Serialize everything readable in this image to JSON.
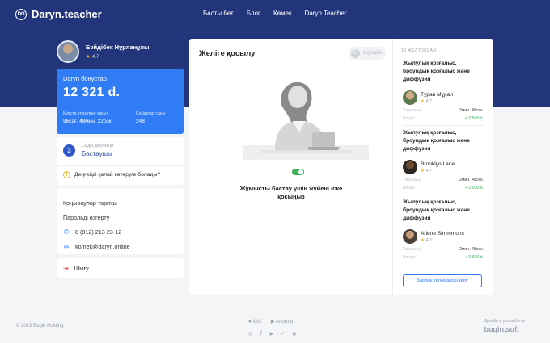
{
  "header": {
    "logo_mark": "DO",
    "brand": "Daryn.teacher",
    "nav": [
      "Басты бет",
      "Блог",
      "Көмек",
      "Daryn Teacher"
    ]
  },
  "profile": {
    "name": "Бәйдібек Нұрланұлы",
    "rating": "4.7"
  },
  "bonus": {
    "title": "Daryn бонустар",
    "amount": "12 321 d.",
    "time_label": "Курста өткізілген уақыт",
    "time_value": "96сағ. 48мин. 22сек.",
    "lessons_label": "Сабақтар саны",
    "lessons_value": "248"
  },
  "level": {
    "number": "3",
    "caption": "Сіздің деңгейіңіз",
    "name": "Бастаушы",
    "question": "Деңгейді қалай көтеруге болады?"
  },
  "menu": {
    "history": "Қоңыраулар тарихы",
    "password": "Парольді өзгерту",
    "phone": "8 (812) 213 23-12",
    "email": "komek@daryn.online",
    "logout": "Шығу"
  },
  "main": {
    "title": "Желіге қосылу",
    "status": "Офлайн",
    "caption": "Жұмысты бастау үшін жүйені іске қосыңыз"
  },
  "sidebar": {
    "date": "12 ЖЕЛТОҚСАН",
    "lessons": [
      {
        "title": "Жылулық қозғалыс, броундық қозғалыс және диффузия",
        "tutor": "Тұран Мұрал",
        "rating": "4.7",
        "time_label": "Уақытың:",
        "time": "2мин. 48сек.",
        "bonus_label": "Бонус:",
        "bonus": "+ 2 500 d."
      },
      {
        "title": "Жылулық қозғалыс, броундық қозғалыс және диффузия",
        "tutor": "Brooklyn Lane",
        "rating": "4.7",
        "time_label": "Уақытың:",
        "time": "2мин. 48сек.",
        "bonus_label": "Бонус:",
        "bonus": "+ 2 500 d."
      },
      {
        "title": "Жылулық қозғалыс, броундық қозғалыс және диффузия",
        "tutor": "Arlene Simmmons",
        "rating": "4.7",
        "time_label": "Уақытың:",
        "time": "2мин. 48сек.",
        "bonus_label": "Бонус:",
        "bonus": "+ 2 500 d."
      }
    ],
    "all_button": "Барлық төлемдерді көру"
  },
  "footer": {
    "copyright": "© 2019 Bugin Holding",
    "ios": "iOS",
    "android": "Android",
    "credit_caption": "Дизайн и разработка",
    "credit_brand": "bugin.soft"
  },
  "colors": {
    "header": "#23357a",
    "accent": "#2f7cf5",
    "success": "#3fb25a",
    "star": "#f3b826"
  }
}
